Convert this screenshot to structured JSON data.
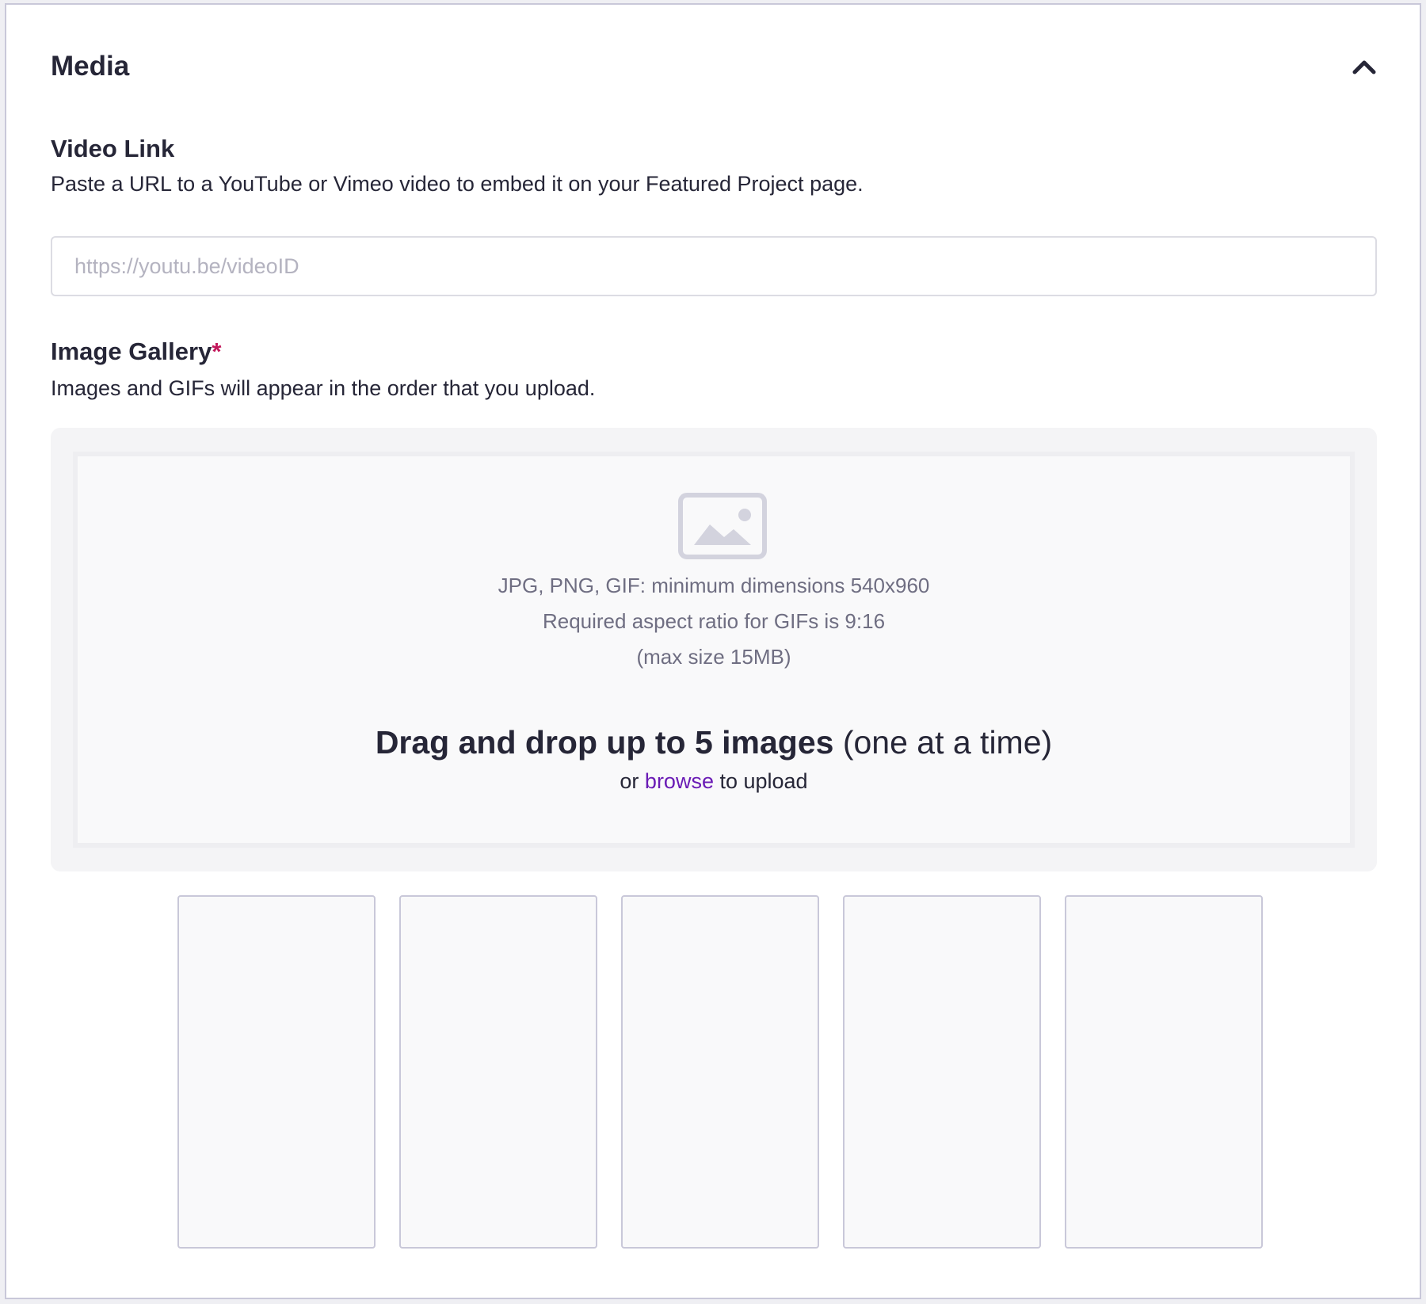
{
  "section": {
    "title": "Media",
    "collapse_icon": "chevron-up-icon"
  },
  "video_link": {
    "label": "Video Link",
    "help": "Paste a URL to a YouTube or Vimeo video to embed it on your Featured Project page.",
    "value": "",
    "placeholder": "https://youtu.be/videoID"
  },
  "image_gallery": {
    "label": "Image Gallery",
    "required_mark": "*",
    "help": "Images and GIFs will appear in the order that you upload.",
    "dropzone": {
      "icon": "image-placeholder-icon",
      "spec_lines": [
        "JPG, PNG, GIF: minimum dimensions 540x960",
        "Required aspect ratio for GIFs is 9:16",
        "(max size 15MB)"
      ],
      "title_bold": "Drag and drop up to 5 images",
      "title_rest": " (one at a time)",
      "browse_prefix": "or ",
      "browse_link": "browse",
      "browse_suffix": " to upload"
    },
    "slot_count": 5
  },
  "colors": {
    "text": "#262637",
    "muted": "#6f6e82",
    "link": "#6a1bb5",
    "required": "#c2185b",
    "border": "#c9c8d9"
  }
}
